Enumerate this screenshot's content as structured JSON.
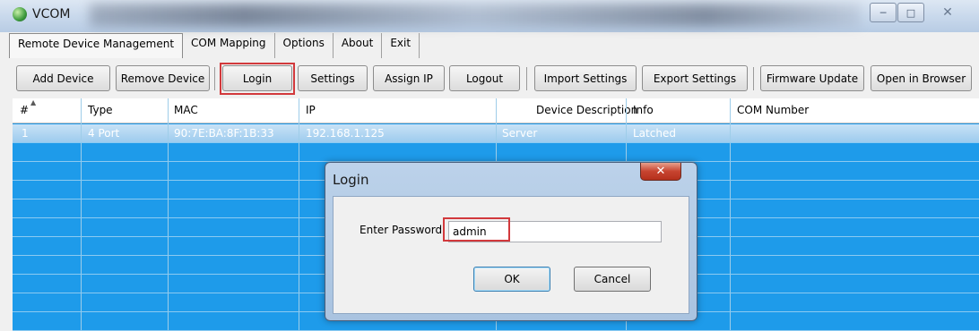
{
  "window": {
    "title": "VCOM"
  },
  "menu": [
    "Remote Device Management",
    "COM Mapping",
    "Options",
    "About",
    "Exit"
  ],
  "toolbar": {
    "add_device": "Add Device",
    "remove_device": "Remove Device",
    "login": "Login",
    "settings": "Settings",
    "assign_ip": "Assign IP",
    "logout": "Logout",
    "import_settings": "Import Settings",
    "export_settings": "Export Settings",
    "firmware_update": "Firmware Update",
    "open_in_browser": "Open in Browser"
  },
  "table": {
    "columns": [
      "#",
      "Type",
      "MAC",
      "IP",
      "Device Description",
      "Info",
      "COM Number"
    ],
    "rows": [
      [
        "1",
        "4 Port",
        "90:7E:BA:8F:1B:33",
        "192.168.1.125",
        "Server",
        "Latched",
        ""
      ]
    ]
  },
  "dialog": {
    "title": "Login",
    "password_label": "Enter Password",
    "password_value": "admin",
    "ok": "OK",
    "cancel": "Cancel"
  },
  "colors": {
    "grid_background": "#1e9bea",
    "highlight": "#d2393c"
  },
  "icons": {
    "app": "globe-icon",
    "minimize": "minimize-icon",
    "maximize": "maximize-icon",
    "close": "close-icon",
    "sort": "sort-arrow-icon"
  }
}
